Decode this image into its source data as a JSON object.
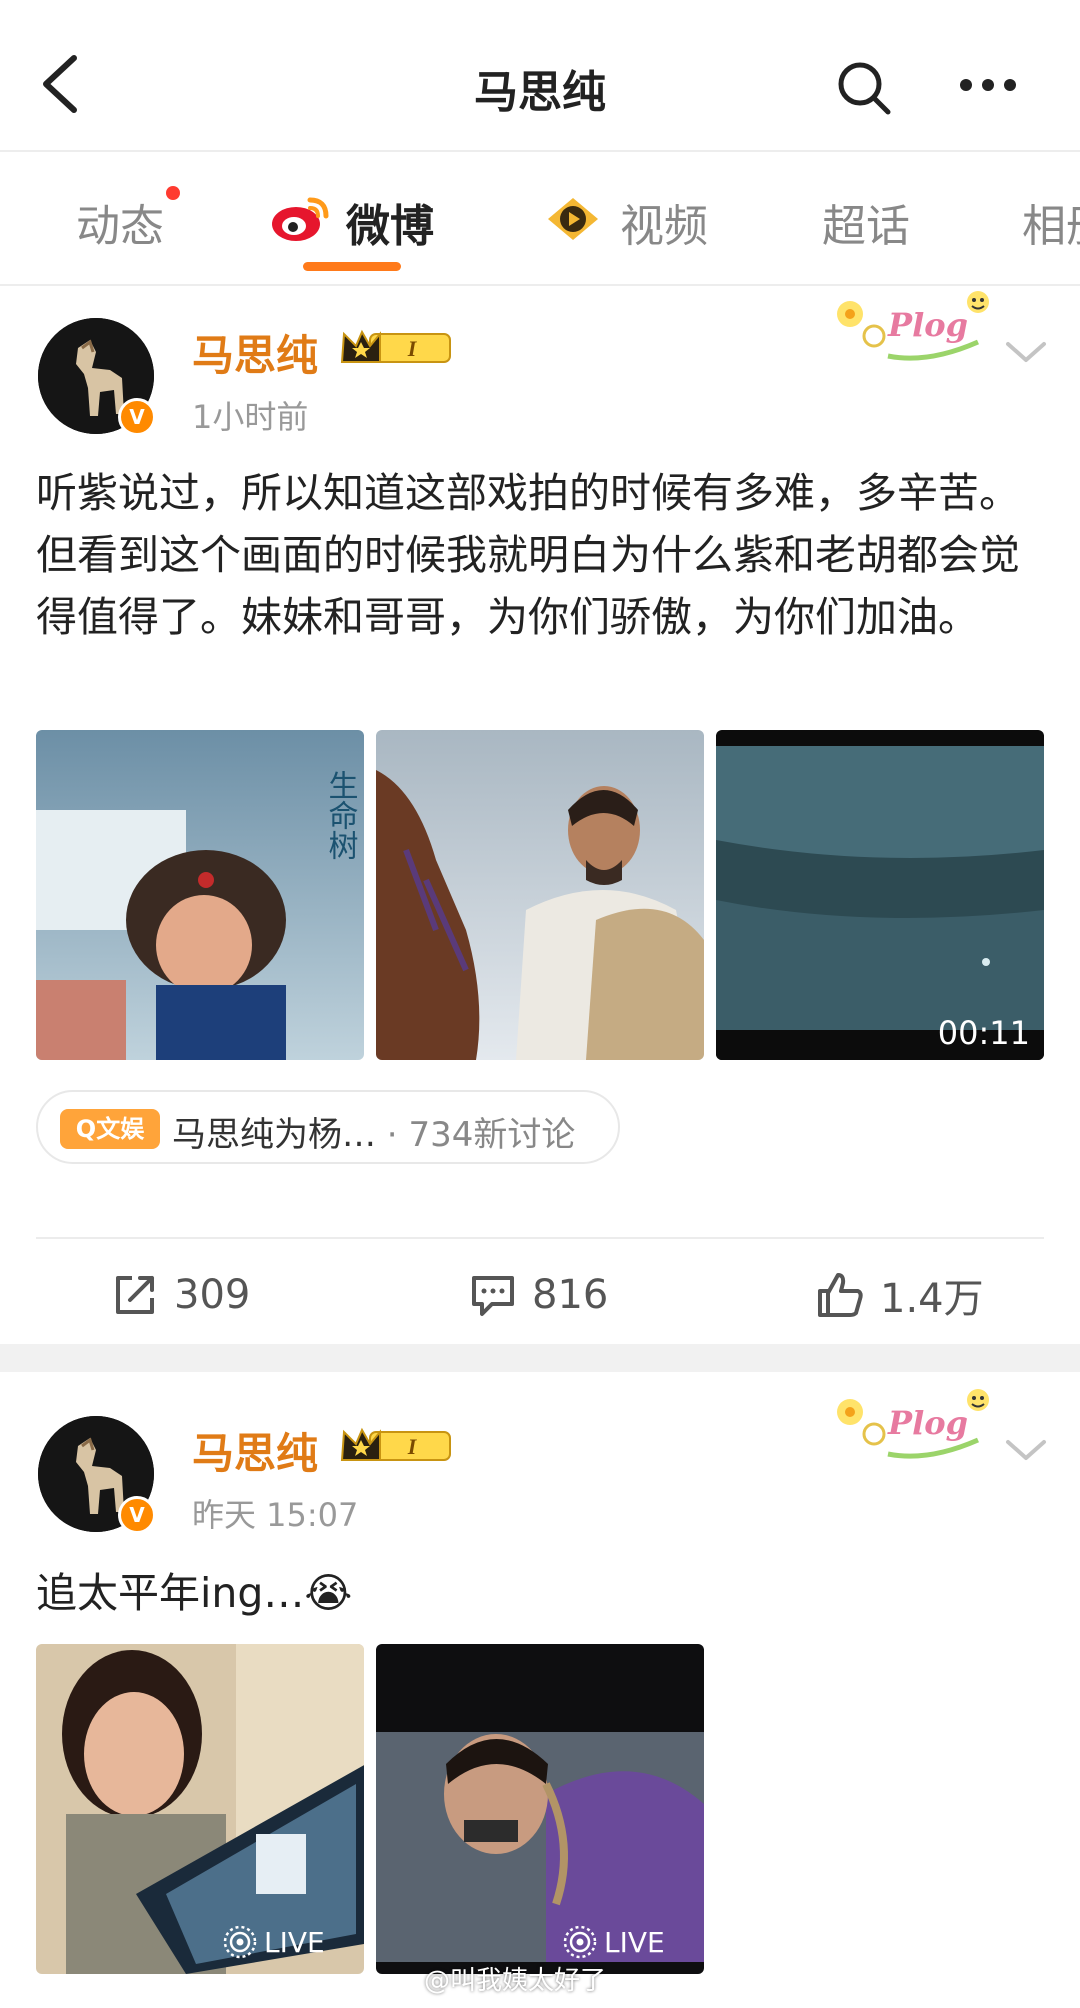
{
  "header": {
    "title": "马思纯"
  },
  "tabs": [
    {
      "label": "动态"
    },
    {
      "label": "微博"
    },
    {
      "label": "视频"
    },
    {
      "label": "超话"
    },
    {
      "label": "相册"
    }
  ],
  "posts": [
    {
      "author": "马思纯",
      "level_badge": "I",
      "verified_badge": "V",
      "time": "1小时前",
      "plog_label": "Plog",
      "text": "听紫说过，所以知道这部戏拍的时候有多难，多辛苦。但看到这个画面的时候我就明白为什么紫和老胡都会觉得值得了。妹妹和哥哥，为你们骄傲，为你们加油。",
      "image_poster_title": "生命树",
      "video_duration": "00:11",
      "topic": {
        "tag": "Q文娱",
        "text": "马思纯为杨…",
        "separator": " · ",
        "count": "734新讨论"
      },
      "actions": {
        "repost": "309",
        "comment": "816",
        "like": "1.4万"
      }
    },
    {
      "author": "马思纯",
      "level_badge": "I",
      "verified_badge": "V",
      "time": "昨天 15:07",
      "plog_label": "Plog",
      "text": "追太平年ing…😭",
      "live_label_1": "LIVE",
      "live_label_2": "LIVE"
    }
  ],
  "watermark": "@叫我姨太好了",
  "colors": {
    "accent": "#ff7a1a",
    "author": "#e07b16",
    "verified": "#ff8a00",
    "notification_dot": "#ff3b30"
  },
  "icons": {
    "back": "chevron-left-icon",
    "search": "search-icon",
    "more": "more-dots-icon",
    "weibo": "weibo-logo-icon",
    "video": "video-channel-icon",
    "repost": "share-icon",
    "comment": "comment-icon",
    "like": "thumbs-up-icon",
    "expand": "chevron-down-icon",
    "live": "live-photo-icon"
  }
}
